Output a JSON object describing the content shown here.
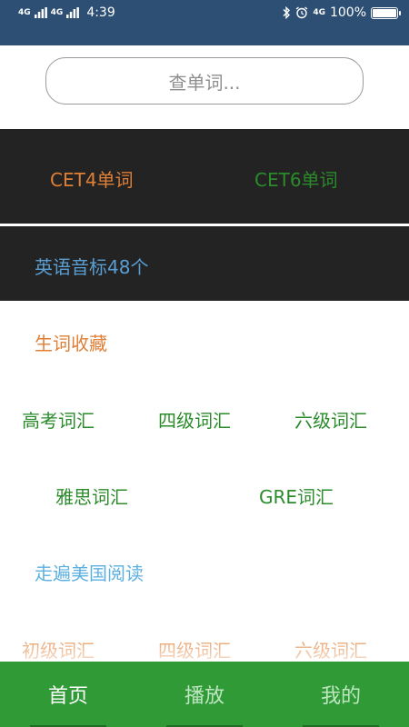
{
  "status_bar": {
    "signal_1": "4G",
    "signal_2": "4G",
    "time": "4:39",
    "network": "4G",
    "battery_text": "100%",
    "battery_level": 1.0,
    "icons": [
      "bluetooth-icon",
      "alarm-icon",
      "signal-bars-icon",
      "battery-icon"
    ]
  },
  "search": {
    "placeholder": "查单词..."
  },
  "cet": {
    "cet4": "CET4单词",
    "cet6": "CET6单词"
  },
  "phonetics": {
    "label": "英语音标48个"
  },
  "sections": {
    "favorites": "生词收藏",
    "row1": [
      "高考词汇",
      "四级词汇",
      "六级词汇"
    ],
    "row2": [
      "雅思词汇",
      "GRE词汇"
    ],
    "reading": "走遍美国阅读",
    "row3": [
      "初级词汇",
      "四级词汇",
      "六级词汇"
    ]
  },
  "tabs": [
    {
      "label": "首页",
      "active": true
    },
    {
      "label": "播放",
      "active": false
    },
    {
      "label": "我的",
      "active": false
    }
  ],
  "colors": {
    "status_bar": "#2d4f73",
    "dark_panel": "#232323",
    "orange": "#e07f36",
    "green": "#2b8b2b",
    "blue": "#5a9fd4",
    "tab_bar": "#2f9a36"
  }
}
